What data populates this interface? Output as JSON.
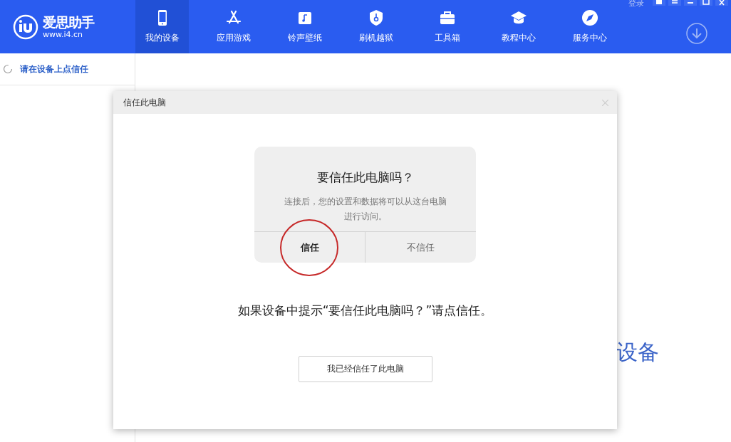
{
  "app": {
    "logo_title": "爱思助手",
    "logo_url": "www.i4.cn",
    "login": "登录"
  },
  "tabs": [
    {
      "label": "我的设备",
      "kind": "phone",
      "selected": true
    },
    {
      "label": "应用游戏",
      "kind": "appstore",
      "selected": false
    },
    {
      "label": "铃声壁纸",
      "kind": "music",
      "selected": false
    },
    {
      "label": "刷机越狱",
      "kind": "shield",
      "selected": false
    },
    {
      "label": "工具箱",
      "kind": "toolbox",
      "selected": false
    },
    {
      "label": "教程中心",
      "kind": "cap",
      "selected": false
    },
    {
      "label": "服务中心",
      "kind": "compass",
      "selected": false
    }
  ],
  "sidebar": {
    "items": [
      {
        "label": "请在设备上点信任"
      }
    ]
  },
  "background_text": "设备",
  "dialog": {
    "title": "信任此电脑",
    "alert": {
      "title": "要信任此电脑吗？",
      "message": "连接后，您的设置和数据将可以从这台电脑进行访问。",
      "buttons": [
        {
          "label": "信任",
          "highlighted": true
        },
        {
          "label": "不信任",
          "highlighted": false
        }
      ]
    },
    "hint": "如果设备中提示“要信任此电脑吗？”请点信任。",
    "button": "我已经信任了此电脑"
  }
}
